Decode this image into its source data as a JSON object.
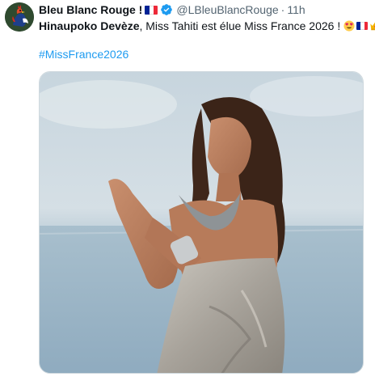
{
  "tweet": {
    "display_name": "Bleu Blanc Rouge !",
    "handle": "@LBleuBlancRouge",
    "separator": "·",
    "time": "11h",
    "text_bold": "Hinaupoko Devèze",
    "text_rest": ", Miss Tahiti est élue Miss France 2026 !",
    "hashtag": "#MissFrance2026",
    "icons": {
      "avatar": "rooster-avatar-icon",
      "verified": "verified-badge-icon",
      "flag": "french-flag-icon",
      "emoji_heart_eyes": "heart-eyes-emoji-icon",
      "emoji_crown": "crown-emoji-icon"
    },
    "colors": {
      "link": "#1d9bf0",
      "secondary_text": "#536471",
      "flag_blue": "#002395",
      "flag_white": "#ffffff",
      "flag_red": "#ed2939"
    }
  }
}
